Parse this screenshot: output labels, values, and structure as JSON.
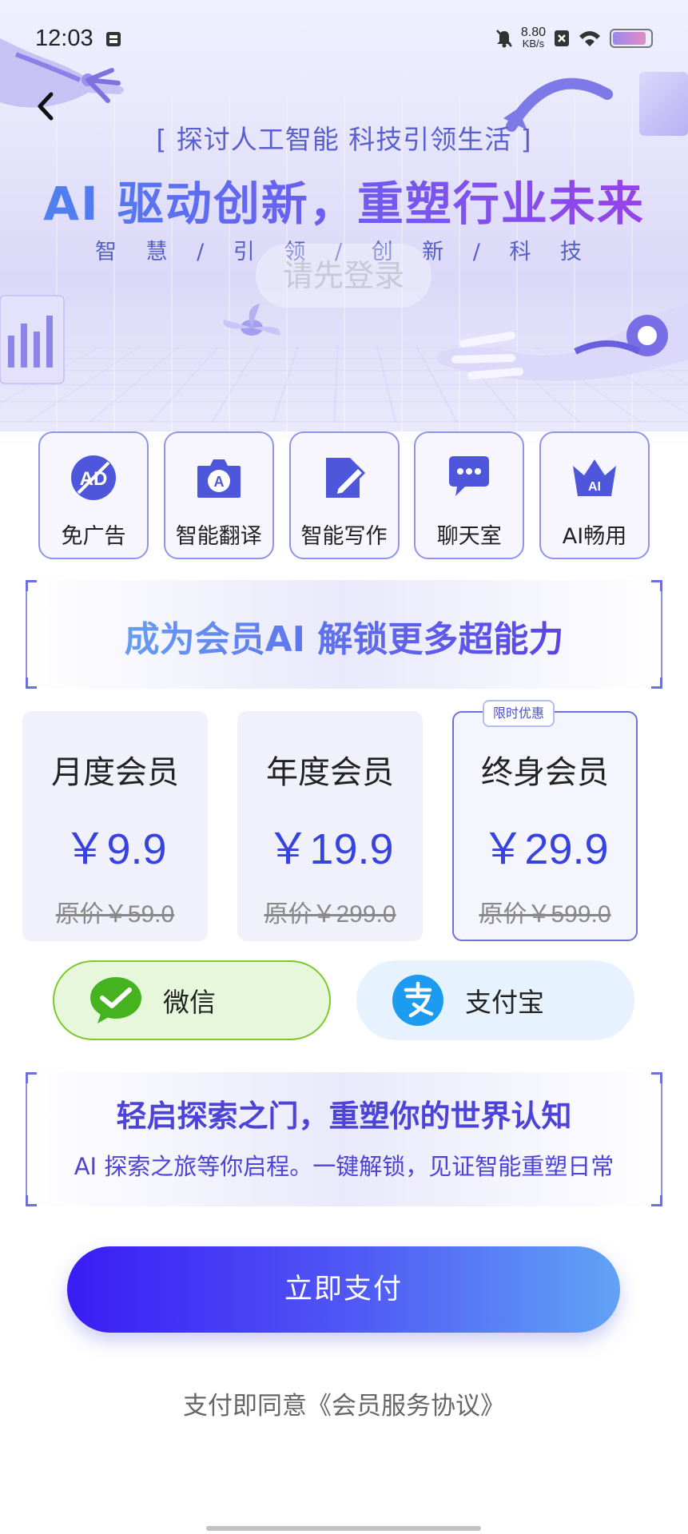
{
  "status_bar": {
    "time": "12:03",
    "net_speed_value": "8.80",
    "net_speed_unit": "KB/s",
    "battery_level": 0.9
  },
  "hero": {
    "tagline": "[ 探讨人工智能 科技引领生活 ]",
    "headline": "AI 驱动创新，重塑行业未来",
    "subline": "智 慧 / 引 领 / 创 新 / 科 技",
    "login_prompt": "请先登录"
  },
  "features": [
    {
      "label": "免广告",
      "icon": "no-ads-icon"
    },
    {
      "label": "智能翻译",
      "icon": "camera-translate-icon"
    },
    {
      "label": "智能写作",
      "icon": "write-icon"
    },
    {
      "label": "聊天室",
      "icon": "chat-icon"
    },
    {
      "label": "AI畅用",
      "icon": "ai-crown-icon"
    }
  ],
  "member_banner": {
    "text": "成为会员AI  解锁更多超能力"
  },
  "plans": [
    {
      "name": "月度会员",
      "price": "￥9.9",
      "original": "原价￥59.0"
    },
    {
      "name": "年度会员",
      "price": "￥19.9",
      "original": "原价￥299.0"
    },
    {
      "name": "终身会员",
      "price": "￥29.9",
      "original": "原价￥599.0",
      "badge": "限时优惠",
      "selected": true
    }
  ],
  "payment_methods": [
    {
      "label": "微信",
      "icon": "wechat-pay-icon",
      "selected": true,
      "color": "#7ec82d"
    },
    {
      "label": "支付宝",
      "icon": "alipay-icon",
      "selected": false,
      "color": "#1d9bf0"
    }
  ],
  "explore_banner": {
    "title": "轻启探索之门，重塑你的世界认知",
    "subtitle": "AI 探索之旅等你启程。一键解锁，见证智能重塑日常"
  },
  "pay_button": {
    "label": "立即支付"
  },
  "agreement": {
    "text": "支付即同意《会员服务协议》"
  },
  "colors": {
    "accent": "#3743e0",
    "pay_gradient_start": "#3a1cf5",
    "pay_gradient_end": "#61a3f5"
  }
}
